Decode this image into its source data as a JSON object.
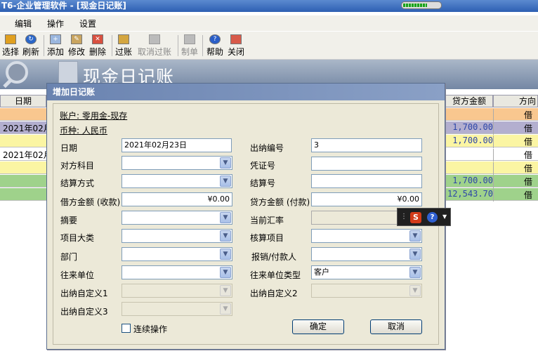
{
  "window": {
    "title": "T6-企业管理软件 - [现金日记账]"
  },
  "menu": [
    "编辑",
    "操作",
    "设置"
  ],
  "toolbar": [
    "选择",
    "刷新",
    "添加",
    "修改",
    "删除",
    "过账",
    "取消过账",
    "制单",
    "帮助",
    "关闭"
  ],
  "banner": {
    "title": "现金日记账"
  },
  "grid": {
    "headers": {
      "date": "日期",
      "credit": "贷方金额",
      "direction": "方向"
    },
    "rows": [
      {
        "date": "",
        "credit": "",
        "dir": "借",
        "bg": "#f9c78f"
      },
      {
        "date": "2021年02月",
        "credit": "1,700.00",
        "dir": "借",
        "bg": "#b3afcf"
      },
      {
        "date": "",
        "credit": "1,700.00",
        "dir": "借",
        "bg": "#fbf5a3"
      },
      {
        "date": "2021年02月",
        "credit": "",
        "dir": "借",
        "bg": "#ffffff"
      },
      {
        "date": "",
        "credit": "",
        "dir": "借",
        "bg": "#fbf5a3"
      },
      {
        "date": "",
        "credit": "1,700.00",
        "dir": "借",
        "bg": "#9fd28b"
      },
      {
        "date": "",
        "credit": "12,543.70",
        "dir": "借",
        "bg": "#9fd28b"
      }
    ]
  },
  "dialog": {
    "title": "增加日记账",
    "account": "账户: 零用金-现存",
    "currency": "币种: 人民币",
    "labels": {
      "date": "日期",
      "counter_subject": "对方科目",
      "settle_method": "结算方式",
      "debit": "借方金额 (收款)",
      "summary": "摘要",
      "project_cat": "项目大类",
      "dept": "部门",
      "partner": "往来单位",
      "custom1": "出纳自定义1",
      "custom3": "出纳自定义3",
      "cashier_no": "出纳编号",
      "voucher_no": "凭证号",
      "settle_no": "结算号",
      "credit": "贷方金额 (付款)",
      "rate": "当前汇率",
      "account_item": "核算项目",
      "payee": "报销/付款人",
      "partner_type": "往来单位类型",
      "custom2": "出纳自定义2"
    },
    "values": {
      "date": "2021年02月23日",
      "cashier_no": "3",
      "debit": "¥0.00",
      "credit": "¥0.00",
      "partner_type": "客户"
    },
    "continuous": "连续操作",
    "ok": "确定",
    "cancel": "取消"
  }
}
